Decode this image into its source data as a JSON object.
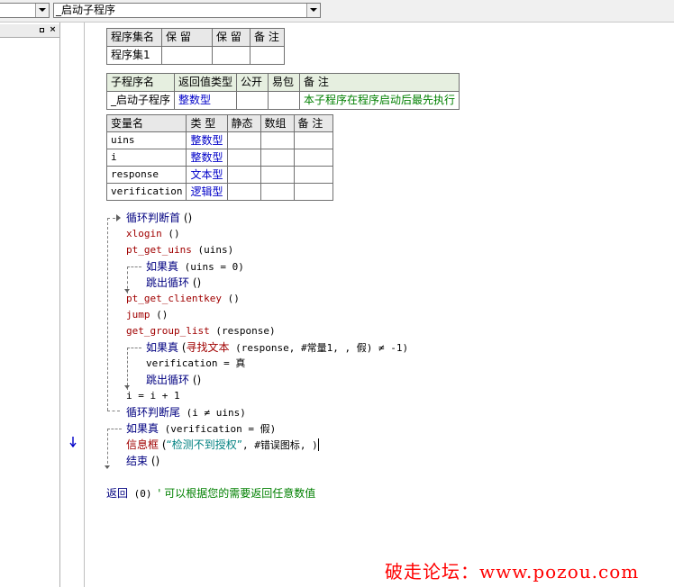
{
  "toolbar": {
    "object_combo_value": "",
    "sub_combo_value": "_启动子程序"
  },
  "left_pane": {
    "pin_label": "□",
    "close_label": "×"
  },
  "assembly_table": {
    "headers": [
      "程序集名",
      "保 留",
      "保 留",
      "备 注"
    ],
    "row": [
      "程序集1",
      "",
      "",
      ""
    ]
  },
  "sub_table": {
    "headers": [
      "子程序名",
      "返回值类型",
      "公开",
      "易包",
      "备 注"
    ],
    "row": [
      "_启动子程序",
      "整数型",
      "",
      "",
      "本子程序在程序启动后最先执行"
    ]
  },
  "var_table": {
    "headers": [
      "变量名",
      "类 型",
      "静态",
      "数组",
      "备 注"
    ],
    "rows": [
      [
        "uins",
        "整数型",
        "",
        "",
        ""
      ],
      [
        "i",
        "整数型",
        "",
        "",
        ""
      ],
      [
        "response",
        "文本型",
        "",
        "",
        ""
      ],
      [
        "verification",
        "逻辑型",
        "",
        "",
        ""
      ]
    ]
  },
  "code": {
    "loop_start": {
      "kw": "循环判断首",
      "args": " ()"
    },
    "l1": {
      "fn": "xlogin",
      "args": " ()"
    },
    "l2": {
      "fn": "pt_get_uins",
      "args": " (uins)"
    },
    "l3": {
      "kw": "如果真",
      "args": " (uins = 0)"
    },
    "l4": {
      "kw": "跳出循环",
      "args": " ()"
    },
    "l5": {
      "fn": "pt_get_clientkey",
      "args": " ()"
    },
    "l6": {
      "fn": "jump",
      "args": " ()"
    },
    "l7": {
      "fn": "get_group_list",
      "args": " (response)"
    },
    "l8": {
      "kw": "如果真",
      "open": " (",
      "fn": "寻找文本",
      "args": " (response, #常量1, , 假) ≠ -1)"
    },
    "l9": {
      "text": "verification = 真"
    },
    "l10": {
      "kw": "跳出循环",
      "args": " ()"
    },
    "l11": {
      "text": "i = i + 1"
    },
    "loop_end": {
      "kw": "循环判断尾",
      "args": " (i ≠ uins)"
    },
    "l12": {
      "kw": "如果真",
      "args": " (verification = 假)"
    },
    "l13": {
      "fn": "信息框",
      "open": " (",
      "str": "“检测不到授权”",
      "args": ", #错误图标, )"
    },
    "l14": {
      "kw": "结束",
      "args": " ()"
    },
    "ret": {
      "kw": "返回",
      "args": " (0) ",
      "comment": "' 可以根据您的需要返回任意数值"
    }
  },
  "watermark": "破走论坛：www.pozou.com",
  "colors": {
    "keyword": "#000080",
    "function": "#a00000",
    "type": "#0000c8",
    "comment": "#008000",
    "string": "#008080"
  }
}
